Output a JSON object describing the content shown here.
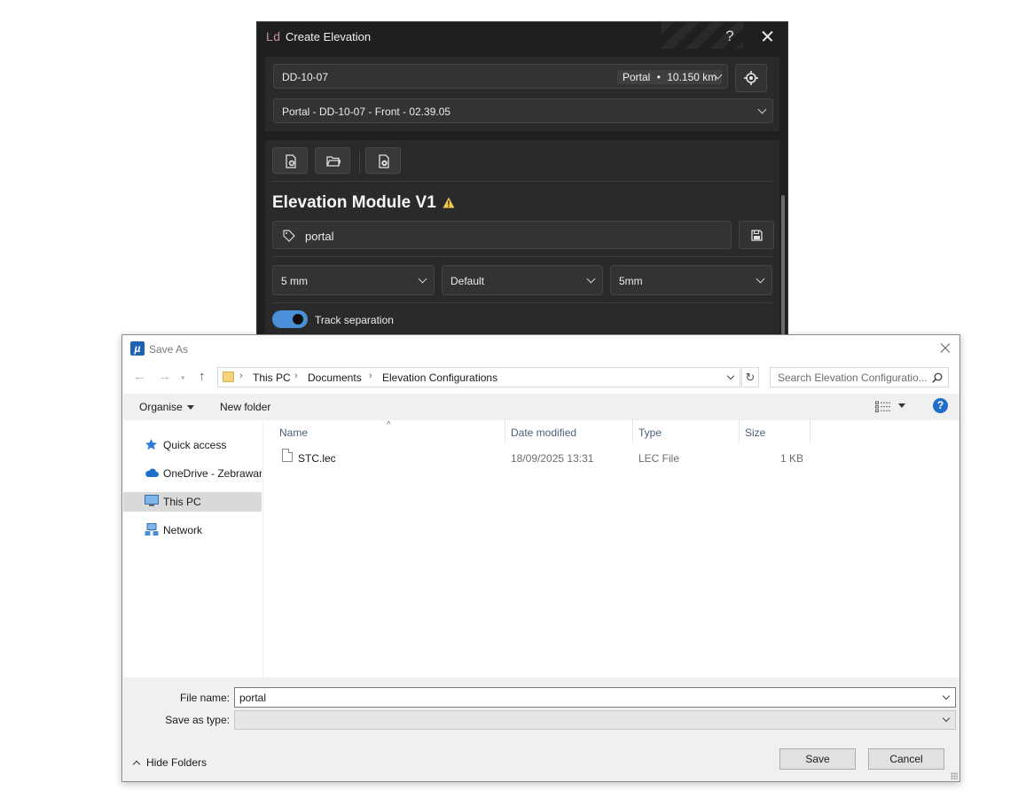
{
  "create_elevation": {
    "logo": "Ld",
    "title": "Create Elevation",
    "help": "?",
    "location_select": {
      "value": "DD-10-07",
      "badge_site": "Portal",
      "badge_dot": "•",
      "badge_distance": "10.150 km"
    },
    "elevation_select": {
      "value": "Portal - DD-10-07 - Front - 02.39.05"
    },
    "module_title": "Elevation Module V1",
    "tag_value": "portal",
    "dropdowns": [
      "5 mm",
      "Default",
      "5mm"
    ],
    "toggle": {
      "label": "Track separation",
      "on": true
    },
    "colors": {
      "toggle_accent": "#4a90d9",
      "warning": "#f2c94c",
      "logo": "#c8939b"
    }
  },
  "save_as": {
    "title": "Save As",
    "breadcrumb": [
      "This PC",
      "Documents",
      "Elevation Configurations"
    ],
    "refresh_icon": "↻",
    "search_placeholder": "Search Elevation Configuratio...",
    "toolbar": {
      "organise": "Organise",
      "new_folder": "New folder",
      "help": "?"
    },
    "nav": [
      {
        "label": "Quick access",
        "icon": "star-icon"
      },
      {
        "label": "OneDrive - Zebraware",
        "icon": "cloud-icon"
      },
      {
        "label": "This PC",
        "icon": "monitor-icon",
        "selected": true
      },
      {
        "label": "Network",
        "icon": "network-icon"
      }
    ],
    "columns": [
      "Name",
      "Date modified",
      "Type",
      "Size"
    ],
    "files": [
      {
        "name": "STC.lec",
        "modified": "18/09/2025 13:31",
        "type": "LEC File",
        "size": "1 KB"
      }
    ],
    "file_name_label": "File name:",
    "file_name_value": "portal",
    "save_type_label": "Save as type:",
    "save_type_value": "",
    "hide_folders": "Hide Folders",
    "save_label": "Save",
    "cancel_label": "Cancel"
  }
}
